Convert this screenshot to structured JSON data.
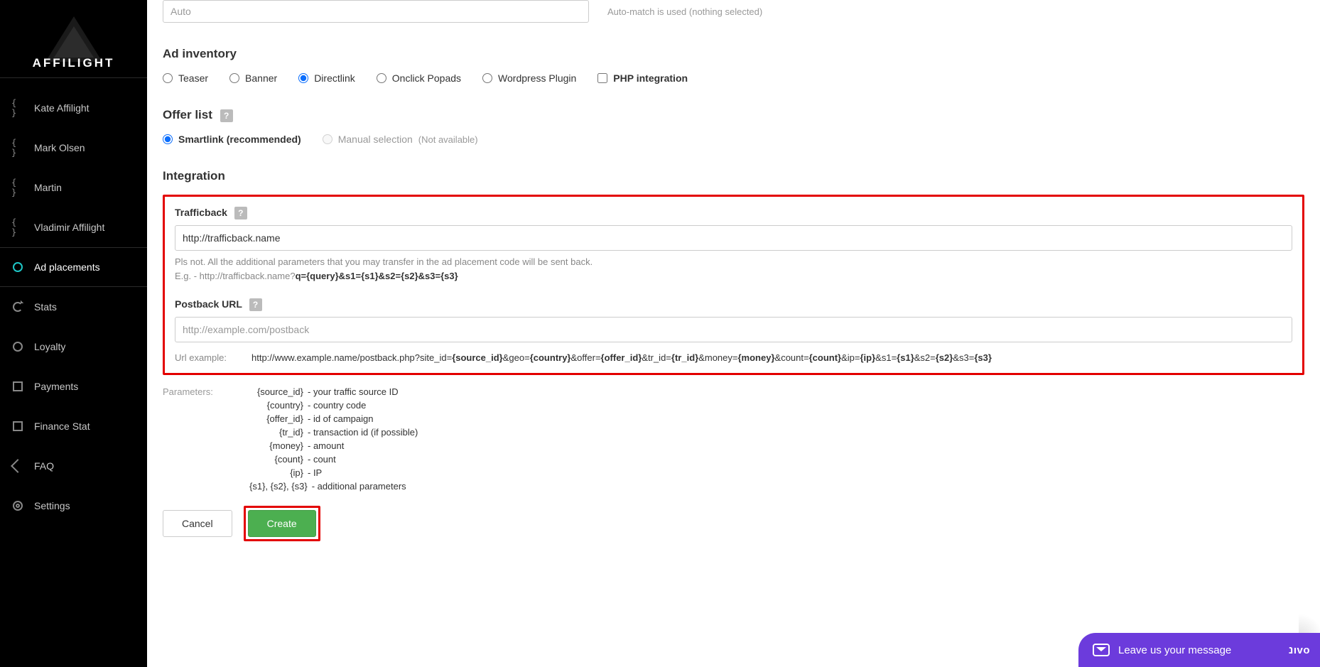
{
  "brand": "AFFILIGHT",
  "sidebar": {
    "items": [
      {
        "label": "Kate Affilight",
        "icon": "braces"
      },
      {
        "label": "Mark Olsen",
        "icon": "braces"
      },
      {
        "label": "Martin",
        "icon": "braces"
      },
      {
        "label": "Vladimir Affilight",
        "icon": "braces"
      },
      {
        "label": "Ad placements",
        "icon": "circle",
        "active": true
      },
      {
        "label": "Stats",
        "icon": "reload"
      },
      {
        "label": "Loyalty",
        "icon": "circle"
      },
      {
        "label": "Payments",
        "icon": "square"
      },
      {
        "label": "Finance Stat",
        "icon": "square"
      },
      {
        "label": "FAQ",
        "icon": "diamond"
      },
      {
        "label": "Settings",
        "icon": "gear"
      }
    ]
  },
  "top_select": {
    "value_placeholder": "Auto",
    "hint": "Auto-match is used (nothing selected)"
  },
  "ad_inventory": {
    "heading": "Ad inventory",
    "options": [
      {
        "label": "Teaser",
        "type": "radio",
        "checked": false
      },
      {
        "label": "Banner",
        "type": "radio",
        "checked": false
      },
      {
        "label": "Directlink",
        "type": "radio",
        "checked": true
      },
      {
        "label": "Onclick Popads",
        "type": "radio",
        "checked": false
      },
      {
        "label": "Wordpress Plugin",
        "type": "radio",
        "checked": false
      },
      {
        "label": "PHP integration",
        "type": "checkbox",
        "checked": false,
        "bold": true
      }
    ]
  },
  "offer_list": {
    "heading": "Offer list",
    "options": [
      {
        "label": "Smartlink (recommended)",
        "checked": true,
        "bold": true
      },
      {
        "label": "Manual selection",
        "checked": false,
        "disabled": true,
        "note": "(Not available)"
      }
    ]
  },
  "integration": {
    "heading": "Integration",
    "trafficback": {
      "label": "Trafficback",
      "value": "http://trafficback.name",
      "note": "Pls not. All the additional parameters that you may transfer in the ad placement code will be sent back.",
      "eg_prefix": "E.g. - http://trafficback.name?",
      "eg_bold": "q={query}&s1={s1}&s2={s2}&s3={s3}"
    },
    "postback": {
      "label": "Postback URL",
      "placeholder": "http://example.com/postback"
    },
    "url_example": {
      "label": "Url example:",
      "prefix": "http://www.example.name/postback.php?site_id=",
      "tokens": [
        "{source_id}",
        "&geo=",
        "{country}",
        "&offer=",
        "{offer_id}",
        "&tr_id=",
        "{tr_id}",
        "&money=",
        "{money}",
        "&count=",
        "{count}",
        "&ip=",
        "{ip}",
        "&s1=",
        "{s1}",
        "&s2=",
        "{s2}",
        "&s3=",
        "{s3}"
      ]
    },
    "parameters": {
      "label": "Parameters:",
      "rows": [
        {
          "k": "{source_id}",
          "d": " - your traffic source ID"
        },
        {
          "k": "{country}",
          "d": " - country code"
        },
        {
          "k": "{offer_id}",
          "d": " - id of campaign"
        },
        {
          "k": "{tr_id}",
          "d": " - transaction id (if possible)"
        },
        {
          "k": "{money}",
          "d": " - amount"
        },
        {
          "k": "{count}",
          "d": " - count"
        },
        {
          "k": "{ip}",
          "d": " - IP"
        },
        {
          "k": "{s1}, {s2}, {s3}",
          "d": " - additional parameters"
        }
      ]
    }
  },
  "buttons": {
    "cancel": "Cancel",
    "create": "Create"
  },
  "chat": {
    "text": "Leave us your message",
    "brand": "נıvo"
  }
}
